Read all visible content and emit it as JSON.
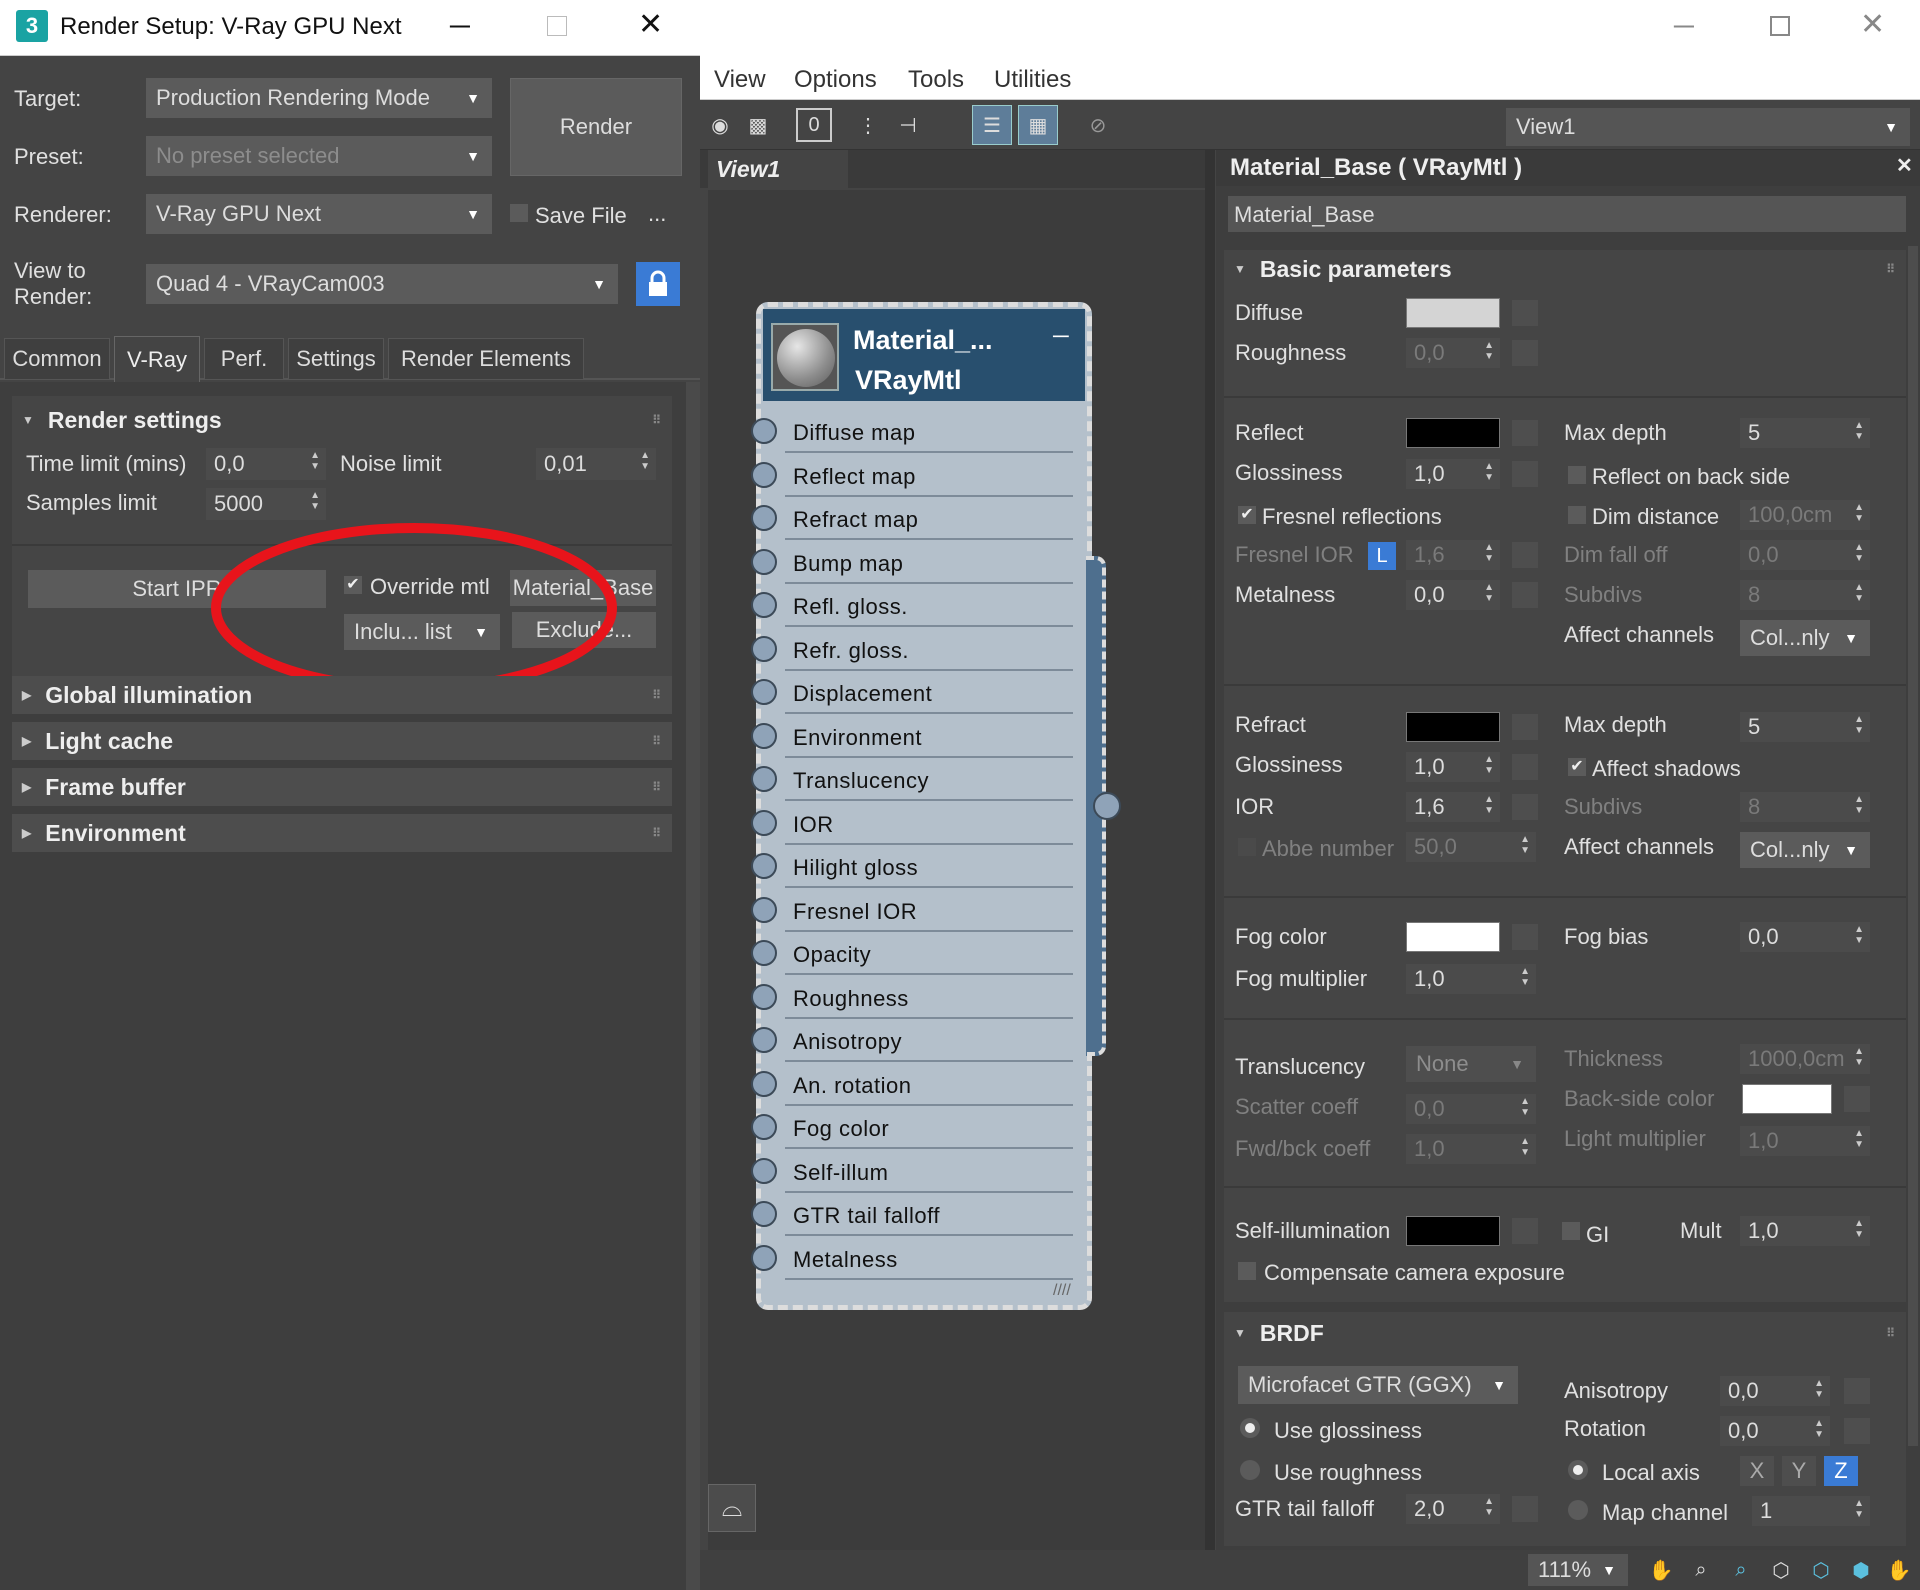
{
  "colors": {
    "accent": "#3a7bd5",
    "node_header": "#284f6e",
    "node_body": "#b4c0cb",
    "annotation_red": "#e8141b"
  },
  "render_setup": {
    "title": "Render Setup: V-Ray GPU Next",
    "target_label": "Target:",
    "target_value": "Production Rendering Mode",
    "preset_label": "Preset:",
    "preset_value": "No preset selected",
    "renderer_label": "Renderer:",
    "renderer_value": "V-Ray GPU Next",
    "view_label_1": "View to",
    "view_label_2": "Render:",
    "view_value": "Quad 4 - VRayCam003",
    "render_button": "Render",
    "save_file": "Save File",
    "more": "...",
    "tabs": [
      "Common",
      "V-Ray",
      "Perf.",
      "Settings",
      "Render Elements"
    ],
    "render_settings": {
      "title": "Render settings",
      "time_limit_label": "Time limit (mins)",
      "time_limit_value": "0,0",
      "noise_limit_label": "Noise limit",
      "noise_limit_value": "0,01",
      "samples_limit_label": "Samples limit",
      "samples_limit_value": "5000",
      "start_ipr": "Start IPR",
      "override_mtl": "Override mtl",
      "material_button": "Material_Base",
      "include_list": "Inclu... list",
      "exclude": "Exclude..."
    },
    "rollouts": [
      "Global illumination",
      "Light cache",
      "Frame buffer",
      "Environment"
    ]
  },
  "slate": {
    "menu": [
      "View",
      "Options",
      "Tools",
      "Utilities"
    ],
    "view_select": "View1",
    "view_tab": "View1",
    "zoom": "111%",
    "node": {
      "title": "Material_...",
      "subtitle": "VRayMtl",
      "slots": [
        "Diffuse map",
        "Reflect map",
        "Refract map",
        "Bump map",
        "Refl. gloss.",
        "Refr. gloss.",
        "Displacement",
        "Environment",
        "Translucency",
        "IOR",
        "Hilight gloss",
        "Fresnel IOR",
        "Opacity",
        "Roughness",
        "Anisotropy",
        "An. rotation",
        "Fog color",
        "Self-illum",
        "GTR tail falloff",
        "Metalness"
      ]
    }
  },
  "material": {
    "header": "Material_Base  ( VRayMtl )",
    "name": "Material_Base",
    "basic": {
      "title": "Basic parameters",
      "diffuse": "Diffuse",
      "roughness": "Roughness",
      "roughness_value": "0,0",
      "reflect": "Reflect",
      "glossiness": "Glossiness",
      "glossiness_value": "1,0",
      "fresnel": "Fresnel reflections",
      "fresnel_ior": "Fresnel IOR",
      "fresnel_ior_lock": "L",
      "fresnel_ior_value": "1,6",
      "metalness": "Metalness",
      "metalness_value": "0,0",
      "max_depth": "Max depth",
      "max_depth_value": "5",
      "reflect_back": "Reflect on back side",
      "dim_distance": "Dim distance",
      "dim_distance_value": "100,0cm",
      "dim_falloff": "Dim fall off",
      "dim_falloff_value": "0,0",
      "subdivs": "Subdivs",
      "subdivs_value": "8",
      "affect_channels": "Affect channels",
      "affect_channels_value": "Col...nly",
      "refract": "Refract",
      "refr_glossiness_value": "1,0",
      "ior": "IOR",
      "ior_value": "1,6",
      "abbe": "Abbe number",
      "abbe_value": "50,0",
      "refr_max_depth_value": "5",
      "affect_shadows": "Affect shadows",
      "refr_subdivs_value": "8",
      "fog_color": "Fog color",
      "fog_bias": "Fog bias",
      "fog_bias_value": "0,0",
      "fog_mult": "Fog multiplier",
      "fog_mult_value": "1,0",
      "translucency": "Translucency",
      "translucency_value": "None",
      "thickness": "Thickness",
      "thickness_value": "1000,0cm",
      "scatter": "Scatter coeff",
      "scatter_value": "0,0",
      "backside": "Back-side color",
      "fwdbck": "Fwd/bck coeff",
      "fwdbck_value": "1,0",
      "light_mult": "Light multiplier",
      "light_mult_value": "1,0",
      "self_illum": "Self-illumination",
      "gi": "GI",
      "mult": "Mult",
      "mult_value": "1,0",
      "compensate": "Compensate camera exposure"
    },
    "brdf": {
      "title": "BRDF",
      "type": "Microfacet GTR (GGX)",
      "use_gloss": "Use glossiness",
      "use_rough": "Use roughness",
      "gtr": "GTR tail falloff",
      "gtr_value": "2,0",
      "aniso": "Anisotropy",
      "aniso_value": "0,0",
      "rotation": "Rotation",
      "rotation_value": "0,0",
      "local_axis": "Local axis",
      "x": "X",
      "y": "Y",
      "z": "Z",
      "map_channel": "Map channel",
      "map_channel_value": "1"
    }
  }
}
